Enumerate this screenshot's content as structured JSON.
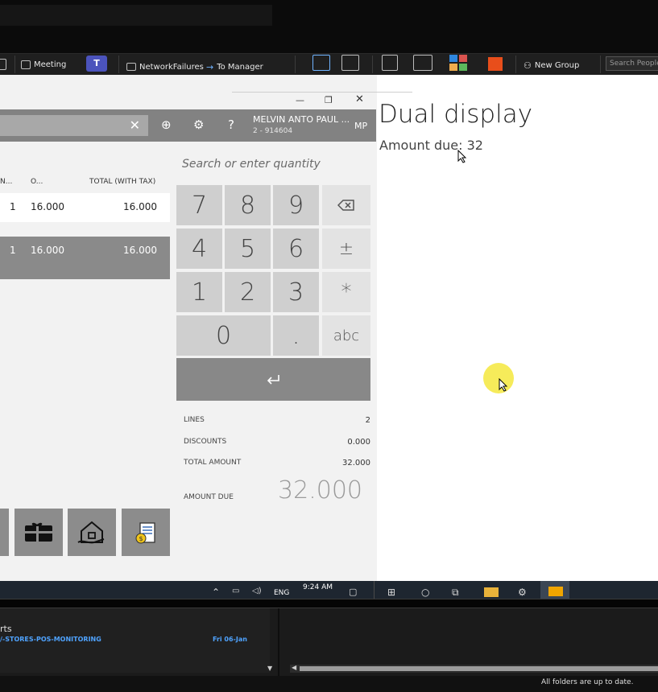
{
  "ribbon": {
    "meeting": "Meeting",
    "network_failures": "NetworkFailures",
    "to_manager": "To Manager",
    "new_group": "New Group",
    "search_people_placeholder": "Search People"
  },
  "pos": {
    "user_name": "MELVIN ANTO PAUL ...",
    "user_id": "2 - 914604",
    "user_initials": "MP",
    "columns": [
      "N...",
      "O...",
      "TOTAL (WITH TAX)"
    ],
    "rows": [
      {
        "qty": "1",
        "price": "16.000",
        "total": "16.000"
      },
      {
        "qty": "1",
        "price": "16.000",
        "total": "16.000"
      }
    ],
    "search_quantity_placeholder": "Search or enter quantity",
    "keypad": {
      "k7": "7",
      "k8": "8",
      "k9": "9",
      "k4": "4",
      "k5": "5",
      "k6": "6",
      "k1": "1",
      "k2": "2",
      "k3": "3",
      "k0": "0",
      "dot": ".",
      "plusminus": "±",
      "multiply": "*",
      "abc": "abc",
      "backspace_icon": "backspace-icon",
      "enter_icon": "enter-icon"
    },
    "totals": {
      "lines_label": "LINES",
      "lines_value": "2",
      "discounts_label": "DISCOUNTS",
      "discounts_value": "0.000",
      "total_amount_label": "TOTAL AMOUNT",
      "total_amount_value": "32.000",
      "amount_due_label": "AMOUNT DUE",
      "amount_due_value": "32.000"
    },
    "tiles": [
      "gift-card-icon",
      "house-delivery-icon",
      "receipt-icon"
    ]
  },
  "dual_display": {
    "title": "Dual display",
    "amount_due": "Amount due: 32"
  },
  "taskbar": {
    "language": "ENG",
    "time": "9:24 AM"
  },
  "outlook": {
    "folder_fragment": "rts",
    "item_fragment": "/-STORES-POS-MONITORING",
    "item_date": "Fri 06-Jan",
    "status": "All folders are up to date."
  },
  "colors": {
    "pos_header": "#828282",
    "selected_row": "#8a8a8a",
    "enter_key": "#888888",
    "link_blue": "#4fa3ff",
    "taskbar": "#1e2630",
    "cursor_highlight": "#f4e73d"
  }
}
